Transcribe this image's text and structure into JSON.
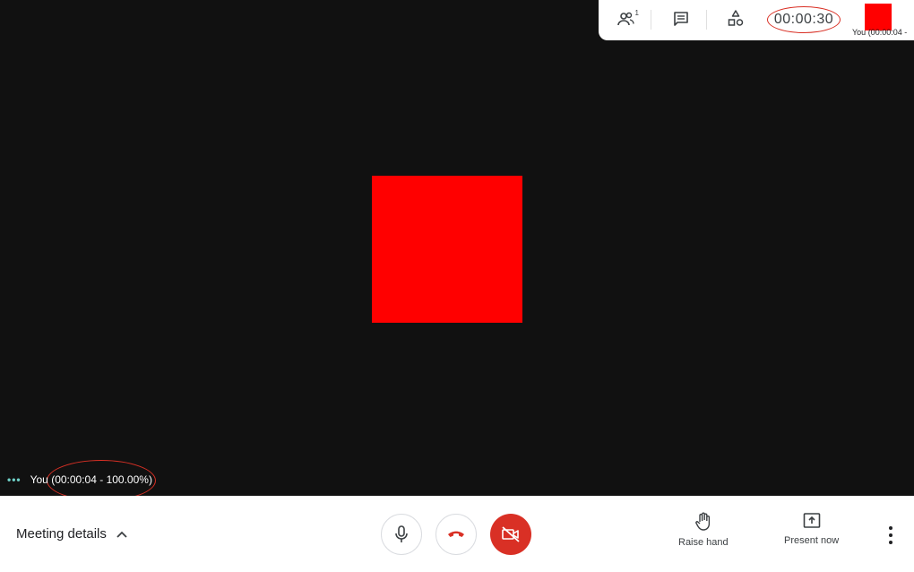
{
  "top_bar": {
    "participants_count": "1",
    "timer": "00:00:30",
    "self_tile_label": "You (00:00:04 -"
  },
  "stage": {
    "self_status": "You (00:00:04 - 100.00%)"
  },
  "bottom_bar": {
    "meeting_details_label": "Meeting details",
    "raise_hand_label": "Raise hand",
    "present_now_label": "Present now"
  },
  "colors": {
    "stage_bg": "#111111",
    "video_tile": "#ff0000",
    "end_call": "#d93025",
    "accent_dots": "#6fd0c7"
  },
  "icons": {
    "participants": "people-icon",
    "chat": "chat-icon",
    "activities": "shapes-icon",
    "mic": "microphone-icon",
    "hangup": "phone-hangup-icon",
    "camera_off": "camera-off-icon",
    "raise_hand": "hand-icon",
    "present": "present-screen-icon",
    "more": "more-vert-icon",
    "expand": "chevron-up-icon"
  }
}
